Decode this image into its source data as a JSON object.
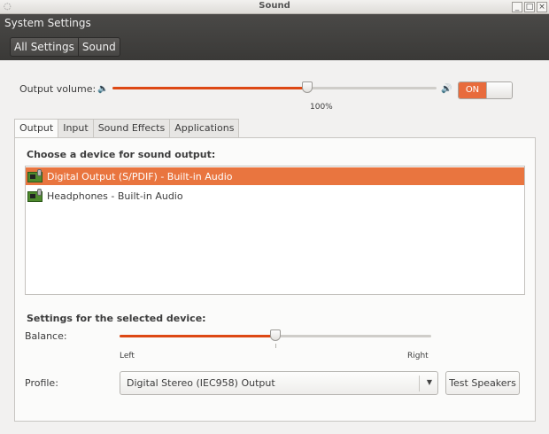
{
  "window": {
    "title": "Sound"
  },
  "header": {
    "app_name": "System Settings",
    "breadcrumbs": [
      "All Settings",
      "Sound"
    ]
  },
  "volume": {
    "label": "Output volume:",
    "level": 0.6,
    "percent_label": "100%",
    "toggle_label": "ON"
  },
  "tabs": [
    {
      "label": "Output",
      "active": true
    },
    {
      "label": "Input"
    },
    {
      "label": "Sound Effects"
    },
    {
      "label": "Applications"
    }
  ],
  "output": {
    "choose_title": "Choose a device for sound output:",
    "devices": [
      {
        "name": "Digital Output (S/PDIF) - Built-in Audio",
        "selected": true,
        "icon": "sound-card-icon"
      },
      {
        "name": "Headphones - Built-in Audio",
        "selected": false,
        "icon": "sound-card-icon"
      }
    ],
    "settings_title": "Settings for the selected device:",
    "balance": {
      "label": "Balance:",
      "value": 0.5,
      "left_label": "Left",
      "right_label": "Right"
    },
    "profile": {
      "label": "Profile:",
      "value": "Digital Stereo (IEC958) Output"
    },
    "test_button": "Test Speakers"
  },
  "colors": {
    "accent": "#dd4814",
    "selection": "#e9753f",
    "header_bg": "#3c3b37"
  }
}
